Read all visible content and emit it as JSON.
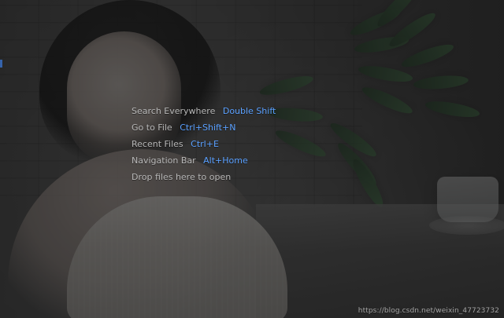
{
  "editor": {
    "hints": [
      {
        "label": "Search Everywhere",
        "shortcut": "Double Shift"
      },
      {
        "label": "Go to File",
        "shortcut": "Ctrl+Shift+N"
      },
      {
        "label": "Recent Files",
        "shortcut": "Ctrl+E"
      },
      {
        "label": "Navigation Bar",
        "shortcut": "Alt+Home"
      },
      {
        "label": "Drop files here to open",
        "shortcut": ""
      }
    ]
  },
  "footer": {
    "watermark": "https://blog.csdn.net/weixin_47723732"
  },
  "colors": {
    "hint_text": "#b7b7b7",
    "shortcut_text": "#5aa0ff",
    "overlay": "#141414"
  }
}
